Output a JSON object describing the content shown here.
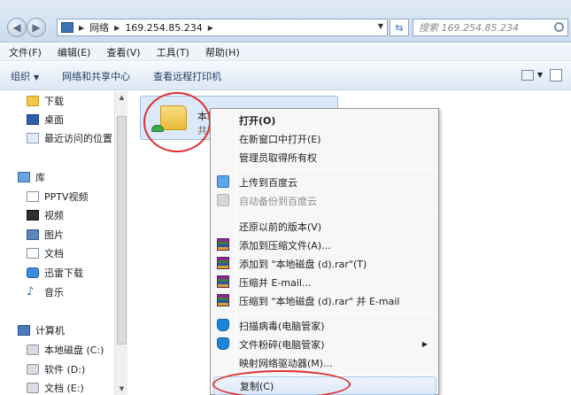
{
  "address_bar": {
    "crumbs": [
      "网络",
      "169.254.85.234"
    ],
    "search_placeholder": "搜索 169.254.85.234"
  },
  "menubar": [
    "文件(F)",
    "编辑(E)",
    "查看(V)",
    "工具(T)",
    "帮助(H)"
  ],
  "toolbar": {
    "organize": "组织",
    "network_center": "网络和共享中心",
    "printers": "查看远程打印机"
  },
  "sidebar": {
    "favorites": [
      {
        "label": "下载",
        "icon": "download-folder-icon"
      },
      {
        "label": "桌面",
        "icon": "desktop-icon"
      },
      {
        "label": "最近访问的位置",
        "icon": "recent-places-icon"
      }
    ],
    "libraries_label": "库",
    "libraries": [
      {
        "label": "PPTV视频",
        "icon": "video-library-icon"
      },
      {
        "label": "视频",
        "icon": "video-icon"
      },
      {
        "label": "图片",
        "icon": "picture-icon"
      },
      {
        "label": "文档",
        "icon": "document-icon"
      },
      {
        "label": "迅雷下载",
        "icon": "thunder-download-icon"
      },
      {
        "label": "音乐",
        "icon": "music-icon"
      }
    ],
    "computer_label": "计算机",
    "drives": [
      {
        "label": "本地磁盘 (C:)",
        "icon": "drive-icon"
      },
      {
        "label": "软件 (D:)",
        "icon": "drive-icon"
      },
      {
        "label": "文档 (E:)",
        "icon": "drive-icon"
      }
    ]
  },
  "shared_folder": {
    "name": "本地磁盘 (d)",
    "status": "共享"
  },
  "context_menu": {
    "items": [
      {
        "label": "打开(O)",
        "bold": true
      },
      {
        "label": "在新窗口中打开(E)"
      },
      {
        "label": "管理员取得所有权"
      },
      {
        "label": "上传到百度云",
        "icon": "baidu-cloud-icon"
      },
      {
        "label": "自动备份到百度云",
        "icon": "baidu-cloud-backup-icon",
        "disabled": true
      },
      {
        "label": "还原以前的版本(V)"
      },
      {
        "label": "添加到压缩文件(A)...",
        "icon": "winrar-icon"
      },
      {
        "label": "添加到 \"本地磁盘 (d).rar\"(T)",
        "icon": "winrar-icon"
      },
      {
        "label": "压缩并 E-mail...",
        "icon": "winrar-icon"
      },
      {
        "label": "压缩到 \"本地磁盘 (d).rar\" 并 E-mail",
        "icon": "winrar-icon"
      },
      {
        "label": "扫描病毒(电脑管家)",
        "icon": "pc-manager-shield-icon"
      },
      {
        "label": "文件粉碎(电脑管家)",
        "icon": "pc-manager-shield-icon",
        "submenu": true
      },
      {
        "label": "映射网络驱动器(M)..."
      },
      {
        "label": "复制(C)",
        "highlighted": true
      }
    ]
  }
}
